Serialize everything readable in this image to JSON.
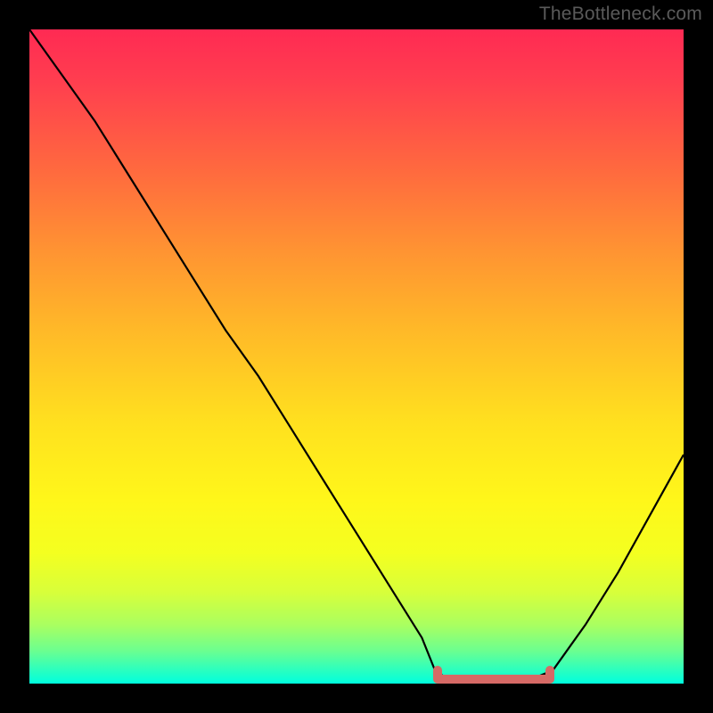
{
  "watermark": "TheBottleneck.com",
  "chart_data": {
    "type": "line",
    "title": "",
    "xlabel": "",
    "ylabel": "",
    "xlim": [
      0,
      100
    ],
    "ylim": [
      0,
      100
    ],
    "x": [
      0,
      5,
      10,
      15,
      20,
      25,
      30,
      35,
      40,
      45,
      50,
      55,
      60,
      62,
      65,
      70,
      75,
      80,
      85,
      90,
      95,
      100
    ],
    "values": [
      100,
      93,
      86,
      78,
      70,
      62,
      54,
      47,
      39,
      31,
      23,
      15,
      7,
      2,
      0,
      0,
      0,
      2,
      9,
      17,
      26,
      35
    ],
    "optimum_range": {
      "start": 62,
      "end": 80
    },
    "gradient": {
      "top": "#ff2a53",
      "mid_upper": "#ff9432",
      "mid": "#ffe01f",
      "mid_lower": "#d8ff3a",
      "bottom": "#00ffde"
    },
    "curve_stroke": "#000000",
    "optimum_color": "#d66a66"
  }
}
